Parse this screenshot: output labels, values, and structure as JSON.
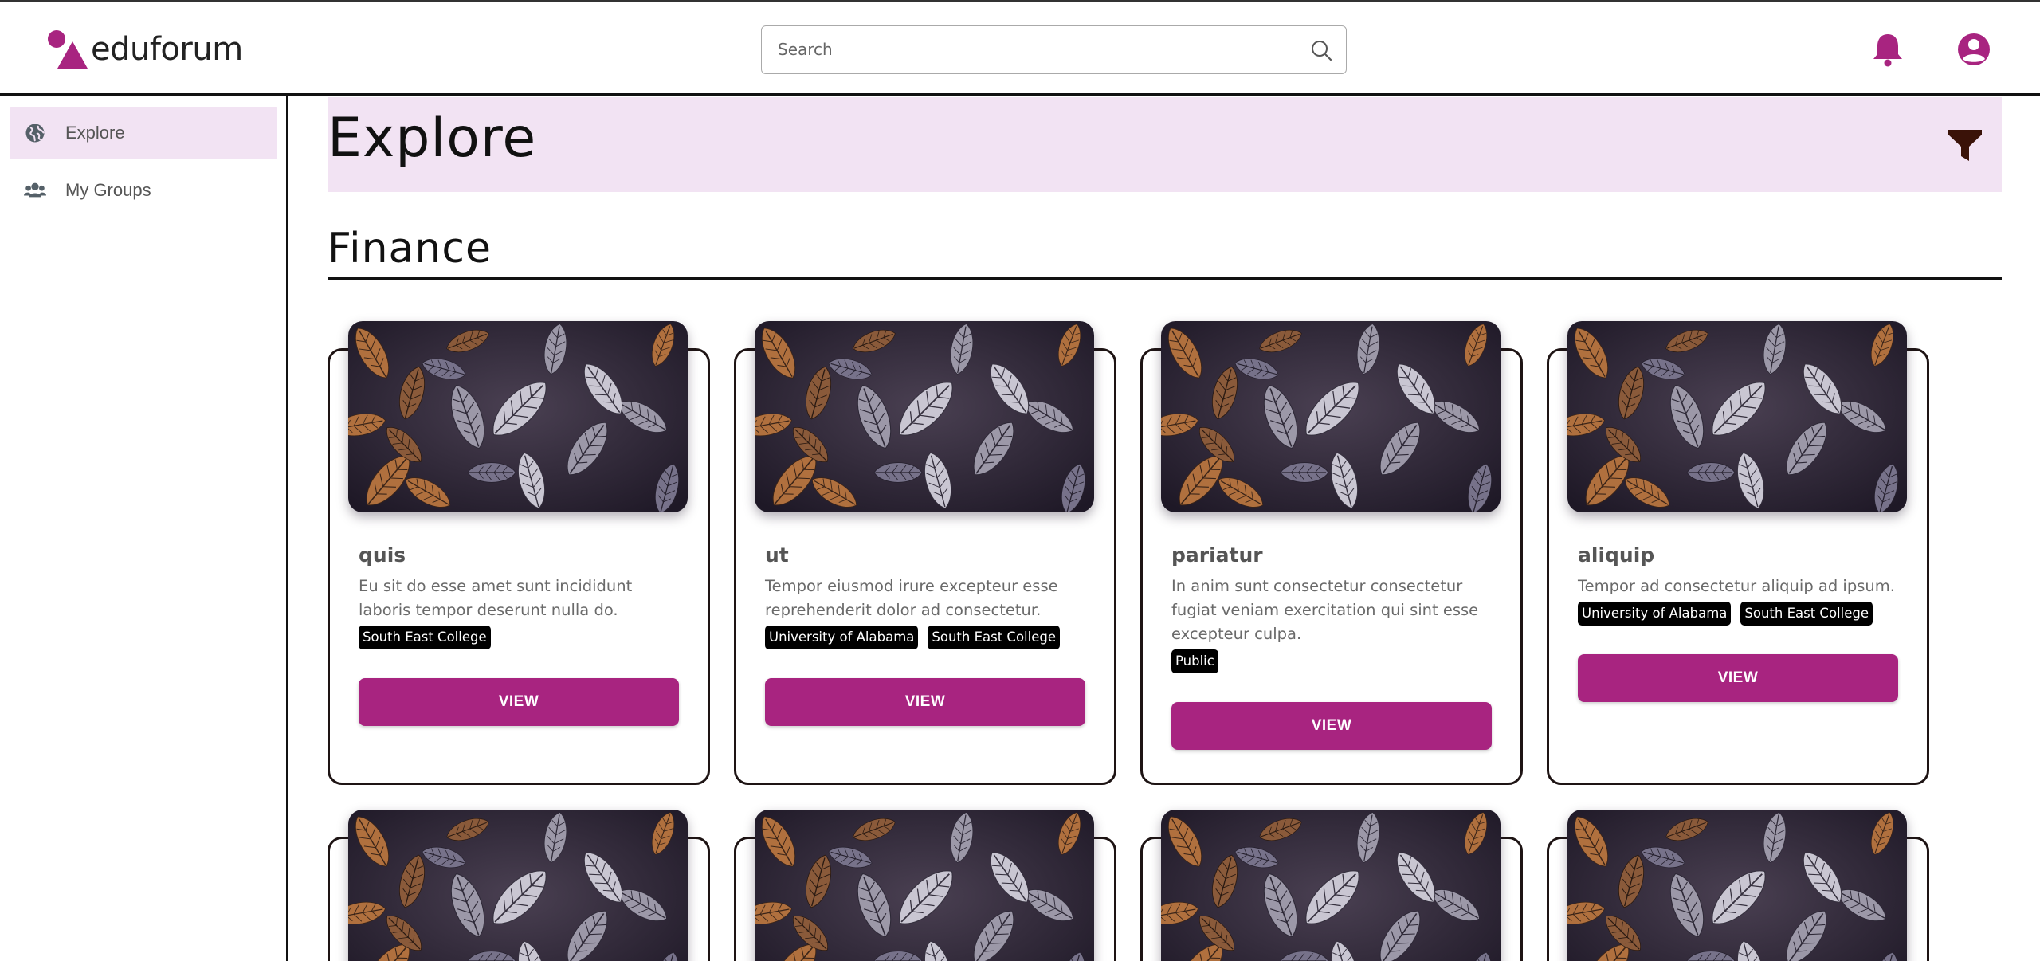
{
  "header": {
    "logo_text": "eduforum",
    "search_placeholder": "Search"
  },
  "sidebar": {
    "items": [
      {
        "label": "Explore",
        "icon": "globe-icon",
        "active": true
      },
      {
        "label": "My Groups",
        "icon": "users-icon",
        "active": false
      }
    ]
  },
  "banner": {
    "title": "Explore"
  },
  "section": {
    "title": "Finance"
  },
  "cards": [
    {
      "title": "quis",
      "description": "Eu sit do esse amet sunt incididunt laboris tempor deserunt nulla do.",
      "tags": [
        "South East College"
      ],
      "button": "VIEW"
    },
    {
      "title": "ut",
      "description": "Tempor eiusmod irure excepteur esse reprehenderit dolor ad consectetur.",
      "tags": [
        "University of Alabama",
        "South East College"
      ],
      "button": "VIEW"
    },
    {
      "title": "pariatur",
      "description": "In anim sunt consectetur consectetur fugiat veniam exercitation qui sint esse excepteur culpa.",
      "tags": [
        "Public"
      ],
      "button": "VIEW"
    },
    {
      "title": "aliquip",
      "description": "Tempor ad consectetur aliquip ad ipsum.",
      "tags": [
        "University of Alabama",
        "South East College"
      ],
      "button": "VIEW"
    }
  ],
  "colors": {
    "accent": "#a82480",
    "highlight_bg": "#f2e3f3",
    "tag_bg": "#000000",
    "border": "#1e1414"
  }
}
